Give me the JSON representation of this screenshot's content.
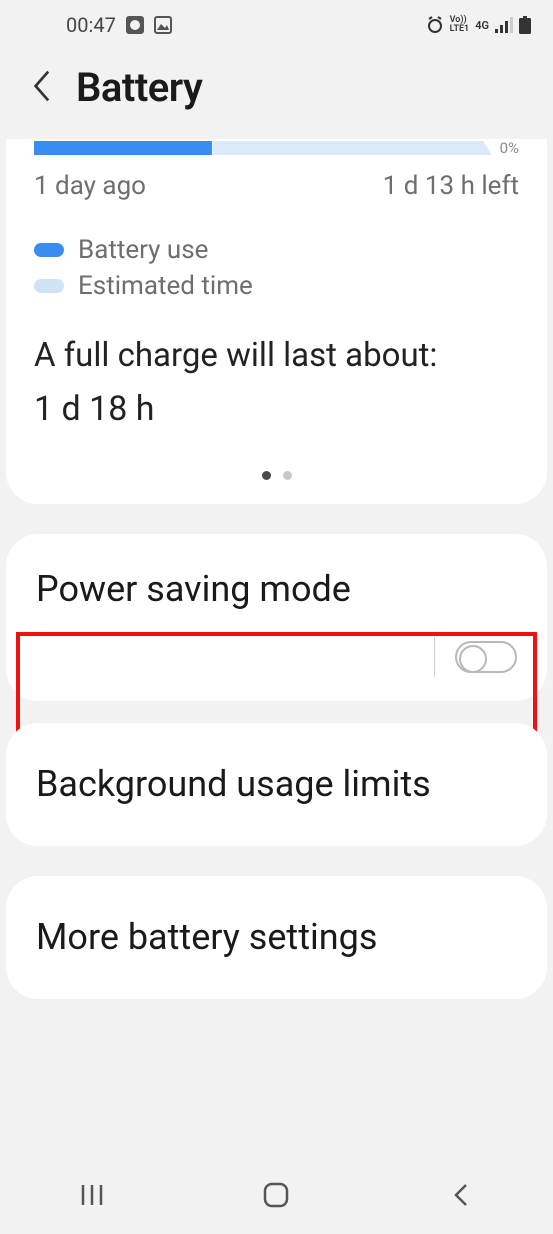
{
  "status": {
    "time": "00:47",
    "network_label": "Vo))\nLTE1",
    "data_label": "4G"
  },
  "header": {
    "title": "Battery"
  },
  "battery": {
    "zero_label": "0%",
    "left_label": "1 day ago",
    "right_label": "1 d 13 h left",
    "legend_use": "Battery use",
    "legend_est": "Estimated time",
    "full_charge_label": "A full charge will last about:",
    "full_charge_value": "1 d 18 h",
    "used_percent": 39
  },
  "settings": {
    "power_saving": {
      "title": "Power saving mode",
      "enabled": false
    },
    "background": {
      "title": "Background usage limits"
    },
    "more": {
      "title": "More battery settings"
    }
  }
}
